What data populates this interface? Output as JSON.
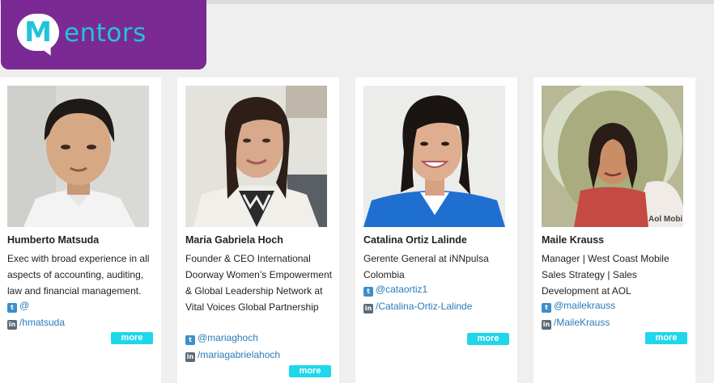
{
  "header": {
    "logo_letter": "M",
    "logo_rest": "entors",
    "accent_color": "#7b2a95",
    "logo_color": "#21c4d6"
  },
  "mentors": [
    {
      "name": "Humberto Matsuda",
      "bio": "Exec with broad experience in all aspects of accounting, auditing, law and financial management.",
      "twitter": "@",
      "linkedin": "/hmatsuda",
      "more": "more"
    },
    {
      "name": "Maria Gabriela Hoch",
      "bio": "Founder & CEO International Doorway Women’s Empowerment & Global Leadership Network at Vital Voices Global Partnership",
      "twitter": "@mariaghoch",
      "linkedin": "/mariagabrielahoch",
      "more": "more"
    },
    {
      "name": "Catalina Ortiz Lalinde",
      "bio": "Gerente General at iNNpulsa Colombia",
      "twitter": "@cataortiz1",
      "linkedin": "/Catalina-Ortiz-Lalinde",
      "more": "more"
    },
    {
      "name": "Maile Krauss",
      "bio": "Manager | West Coast Mobile Sales Strategy | Sales Development at AOL",
      "twitter": "@mailekrauss",
      "linkedin": "/MaileKrauss",
      "more": "more",
      "photo_watermark": "Aol Mobi"
    }
  ],
  "icons": {
    "twitter": "twitter-icon",
    "linkedin": "linkedin-icon"
  }
}
